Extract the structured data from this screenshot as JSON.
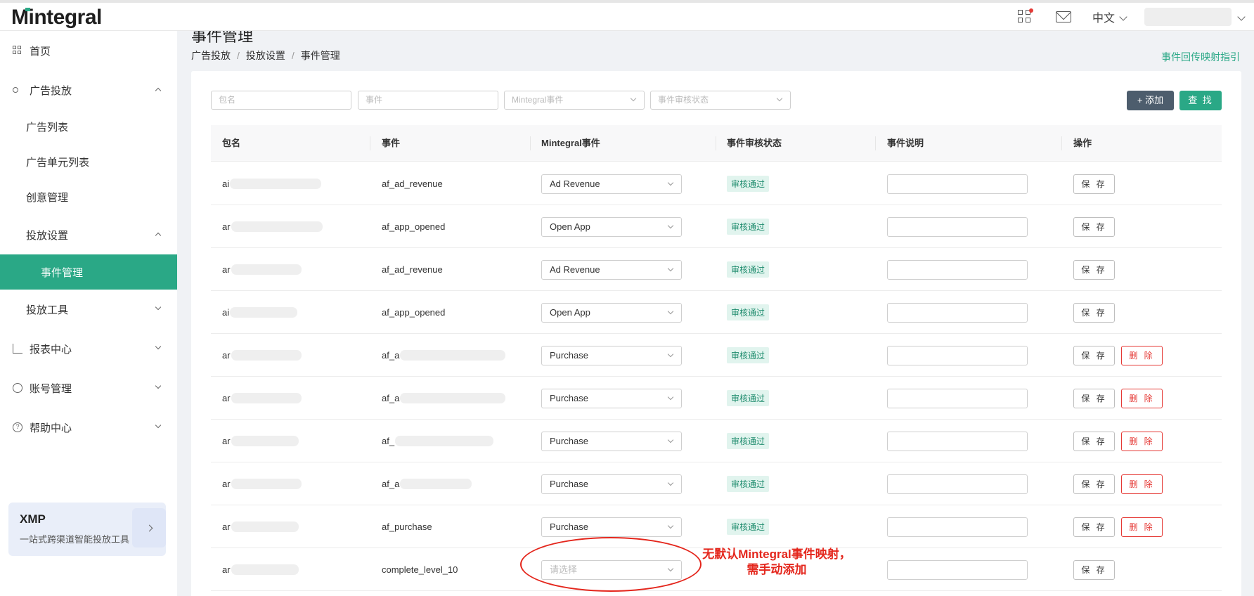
{
  "header": {
    "logo": "Mintegral",
    "language": "中文"
  },
  "sidebar": {
    "items": [
      {
        "label": "首页"
      },
      {
        "label": "广告投放"
      },
      {
        "label": "广告列表"
      },
      {
        "label": "广告单元列表"
      },
      {
        "label": "创意管理"
      },
      {
        "label": "投放设置"
      },
      {
        "label": "事件管理"
      },
      {
        "label": "投放工具"
      },
      {
        "label": "报表中心"
      },
      {
        "label": "账号管理"
      },
      {
        "label": "帮助中心"
      }
    ],
    "xmp": {
      "title": "XMP",
      "subtitle": "一站式跨渠道智能投放工具"
    }
  },
  "page": {
    "title": "事件管理",
    "breadcrumb": [
      "广告投放",
      "投放设置",
      "事件管理"
    ],
    "guide_link": "事件回传映射指引"
  },
  "filters": {
    "package_placeholder": "包名",
    "event_placeholder": "事件",
    "mintegral_event_placeholder": "Mintegral事件",
    "status_placeholder": "事件审核状态",
    "add_label": "+ 添加",
    "find_label": "查 找"
  },
  "table": {
    "columns": [
      "包名",
      "事件",
      "Mintegral事件",
      "事件审核状态",
      "事件说明",
      "操作"
    ],
    "rows": [
      {
        "package_prefix": "ai",
        "event": "af_ad_revenue",
        "mintegral_event": "Ad Revenue",
        "status": "审核通过",
        "save": "保 存",
        "delete": ""
      },
      {
        "package_prefix": "ar",
        "event": "af_app_opened",
        "mintegral_event": "Open App",
        "status": "审核通过",
        "save": "保 存",
        "delete": ""
      },
      {
        "package_prefix": "ar",
        "event": "af_ad_revenue",
        "mintegral_event": "Ad Revenue",
        "status": "审核通过",
        "save": "保 存",
        "delete": ""
      },
      {
        "package_prefix": "ai",
        "event": "af_app_opened",
        "mintegral_event": "Open App",
        "status": "审核通过",
        "save": "保 存",
        "delete": ""
      },
      {
        "package_prefix": "ar",
        "event": "af_a",
        "mintegral_event": "Purchase",
        "status": "审核通过",
        "save": "保 存",
        "delete": "删 除"
      },
      {
        "package_prefix": "ar",
        "event": "af_a",
        "mintegral_event": "Purchase",
        "status": "审核通过",
        "save": "保 存",
        "delete": "删 除"
      },
      {
        "package_prefix": "ar",
        "event": "af_",
        "mintegral_event": "Purchase",
        "status": "审核通过",
        "save": "保 存",
        "delete": "删 除"
      },
      {
        "package_prefix": "ar",
        "event": "af_a",
        "mintegral_event": "Purchase",
        "status": "审核通过",
        "save": "保 存",
        "delete": "删 除"
      },
      {
        "package_prefix": "ar",
        "event": "af_purchase",
        "mintegral_event": "Purchase",
        "status": "审核通过",
        "save": "保 存",
        "delete": "删 除"
      },
      {
        "package_prefix": "ar",
        "event": "complete_level_10",
        "mintegral_event": "",
        "mintegral_placeholder": "请选择",
        "status": "",
        "save": "保 存",
        "delete": ""
      }
    ]
  },
  "annotation": {
    "line1": "无默认Mintegral事件映射，",
    "line2": "需手动添加",
    "color": "#e4261c"
  },
  "colors": {
    "accent": "#2aa886",
    "danger": "#e53935",
    "add_button": "#4d5d6d"
  }
}
